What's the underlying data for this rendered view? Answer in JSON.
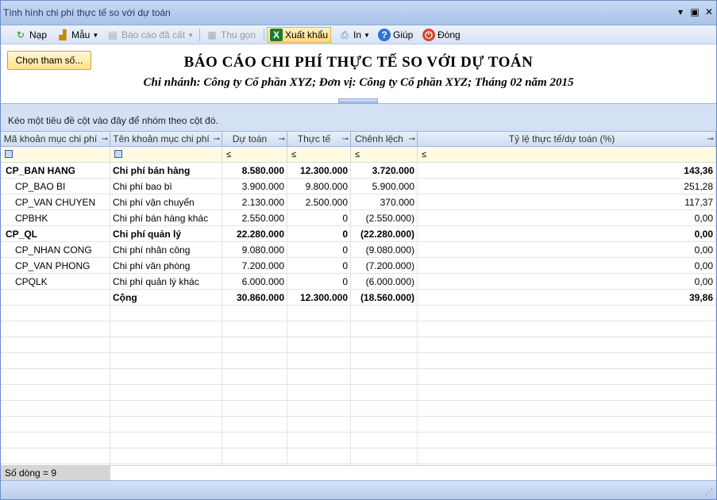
{
  "window": {
    "title": "Tình hình chi phí thực tế so với dự toán"
  },
  "toolbar": {
    "nap": "Nạp",
    "mau": "Mẫu",
    "saved_reports": "Báo cáo đã cất",
    "collapse": "Thu gọn",
    "export": "Xuất khẩu",
    "print": "In",
    "help": "Giúp",
    "close": "Đóng"
  },
  "header": {
    "params_button": "Chọn tham số...",
    "title": "BÁO CÁO CHI PHÍ THỰC TẾ SO VỚI DỰ TOÁN",
    "subtitle": "Chi nhánh: Công ty Cổ phần XYZ; Đơn vị: Công ty Cổ phần XYZ; Tháng 02 năm 2015"
  },
  "group_hint": "Kéo một tiêu đề cột vào đây để nhóm theo cột đó.",
  "columns": [
    "Mã khoản mục chi phí",
    "Tên khoản mục chi phí",
    "Dự toán",
    "Thực tế",
    "Chênh lệch",
    "Tỷ lệ thực tế/dự toán (%)"
  ],
  "filter_ops": [
    "≤",
    "≤",
    "≤",
    "≤"
  ],
  "rows": [
    {
      "code": "CP_BAN HANG",
      "name": "Chi phí bán hàng",
      "budget": "8.580.000",
      "actual": "12.300.000",
      "diff": "3.720.000",
      "ratio": "143,36",
      "bold": true,
      "indent": false
    },
    {
      "code": "CP_BAO BI",
      "name": "Chi phí bao bì",
      "budget": "3.900.000",
      "actual": "9.800.000",
      "diff": "5.900.000",
      "ratio": "251,28",
      "bold": false,
      "indent": true
    },
    {
      "code": "CP_VAN CHUYEN",
      "name": "Chi phí vận chuyển",
      "budget": "2.130.000",
      "actual": "2.500.000",
      "diff": "370.000",
      "ratio": "117,37",
      "bold": false,
      "indent": true
    },
    {
      "code": "CPBHK",
      "name": "Chi phí bán hàng khác",
      "budget": "2.550.000",
      "actual": "0",
      "diff": "(2.550.000)",
      "ratio": "0,00",
      "bold": false,
      "indent": true
    },
    {
      "code": "CP_QL",
      "name": "Chi phí quản lý",
      "budget": "22.280.000",
      "actual": "0",
      "diff": "(22.280.000)",
      "ratio": "0,00",
      "bold": true,
      "indent": false
    },
    {
      "code": "CP_NHAN CONG",
      "name": "Chi phí nhân công",
      "budget": "9.080.000",
      "actual": "0",
      "diff": "(9.080.000)",
      "ratio": "0,00",
      "bold": false,
      "indent": true
    },
    {
      "code": "CP_VAN PHONG",
      "name": "Chi phí văn phòng",
      "budget": "7.200.000",
      "actual": "0",
      "diff": "(7.200.000)",
      "ratio": "0,00",
      "bold": false,
      "indent": true
    },
    {
      "code": "CPQLK",
      "name": "Chi phí quản lý khác",
      "budget": "6.000.000",
      "actual": "0",
      "diff": "(6.000.000)",
      "ratio": "0,00",
      "bold": false,
      "indent": true
    },
    {
      "code": "",
      "name": "Cộng",
      "budget": "30.860.000",
      "actual": "12.300.000",
      "diff": "(18.560.000)",
      "ratio": "39,86",
      "bold": true,
      "indent": false
    }
  ],
  "status": {
    "row_count": "Số dòng = 9"
  },
  "colors": {
    "titlebar": "#a9c2e8",
    "group_bar": "#d4e1f5",
    "filter_row": "#fffbe0",
    "active_button": "#ffd97a"
  }
}
